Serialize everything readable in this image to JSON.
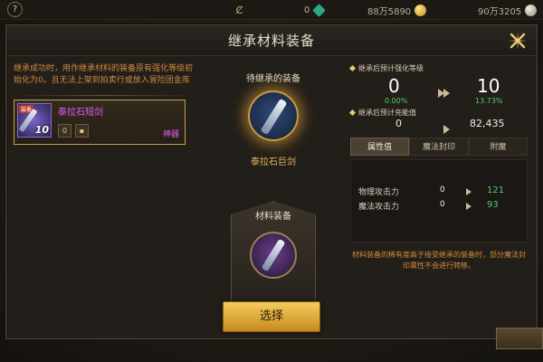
{
  "topbar": {
    "left_icon": "?",
    "currencies": [
      {
        "icon": "c-currency-icon",
        "value": "0"
      },
      {
        "icon": "gem-icon",
        "value": "88万5890"
      },
      {
        "icon": "gold-coin-icon",
        "value": "90万3205"
      }
    ]
  },
  "dialog": {
    "title": "继承材料装备",
    "close_icon": "close-x-icon"
  },
  "left": {
    "notice": "继承成功时，用作继承材料的装备原有强化等级初始化为0。且无法上架到拍卖行或放入冒险团金库",
    "item": {
      "name": "泰拉石短剑",
      "level": "10",
      "tag": "装备",
      "grade": "神器",
      "icons": [
        "0",
        ""
      ]
    }
  },
  "center": {
    "target_label": "待继承的装备",
    "target_name": "泰拉石巨剑",
    "material_label": "材料装备"
  },
  "right": {
    "level_label": "继承后预计强化等级",
    "level_from": "0",
    "level_from_pct": "0.00%",
    "level_to": "10",
    "level_to_pct": "13.73%",
    "charge_label": "继承后预计充能值",
    "charge_from": "0",
    "charge_to": "82,435",
    "tabs": [
      "属性值",
      "魔法封印",
      "附魔"
    ],
    "active_tab": 0,
    "stats": [
      {
        "name": "物理攻击力",
        "from": "0",
        "to": "121"
      },
      {
        "name": "魔法攻击力",
        "from": "0",
        "to": "93"
      }
    ],
    "note": "材料装备的稀有度高于接受继承的装备时，部分魔法封印属性不会进行转移。"
  },
  "select_button": "选择",
  "colors": {
    "accent_gold": "#e6b85d",
    "epic_purple": "#e05cf0",
    "gain_green": "#4fd06b",
    "warn_orange": "#d28a3e"
  }
}
